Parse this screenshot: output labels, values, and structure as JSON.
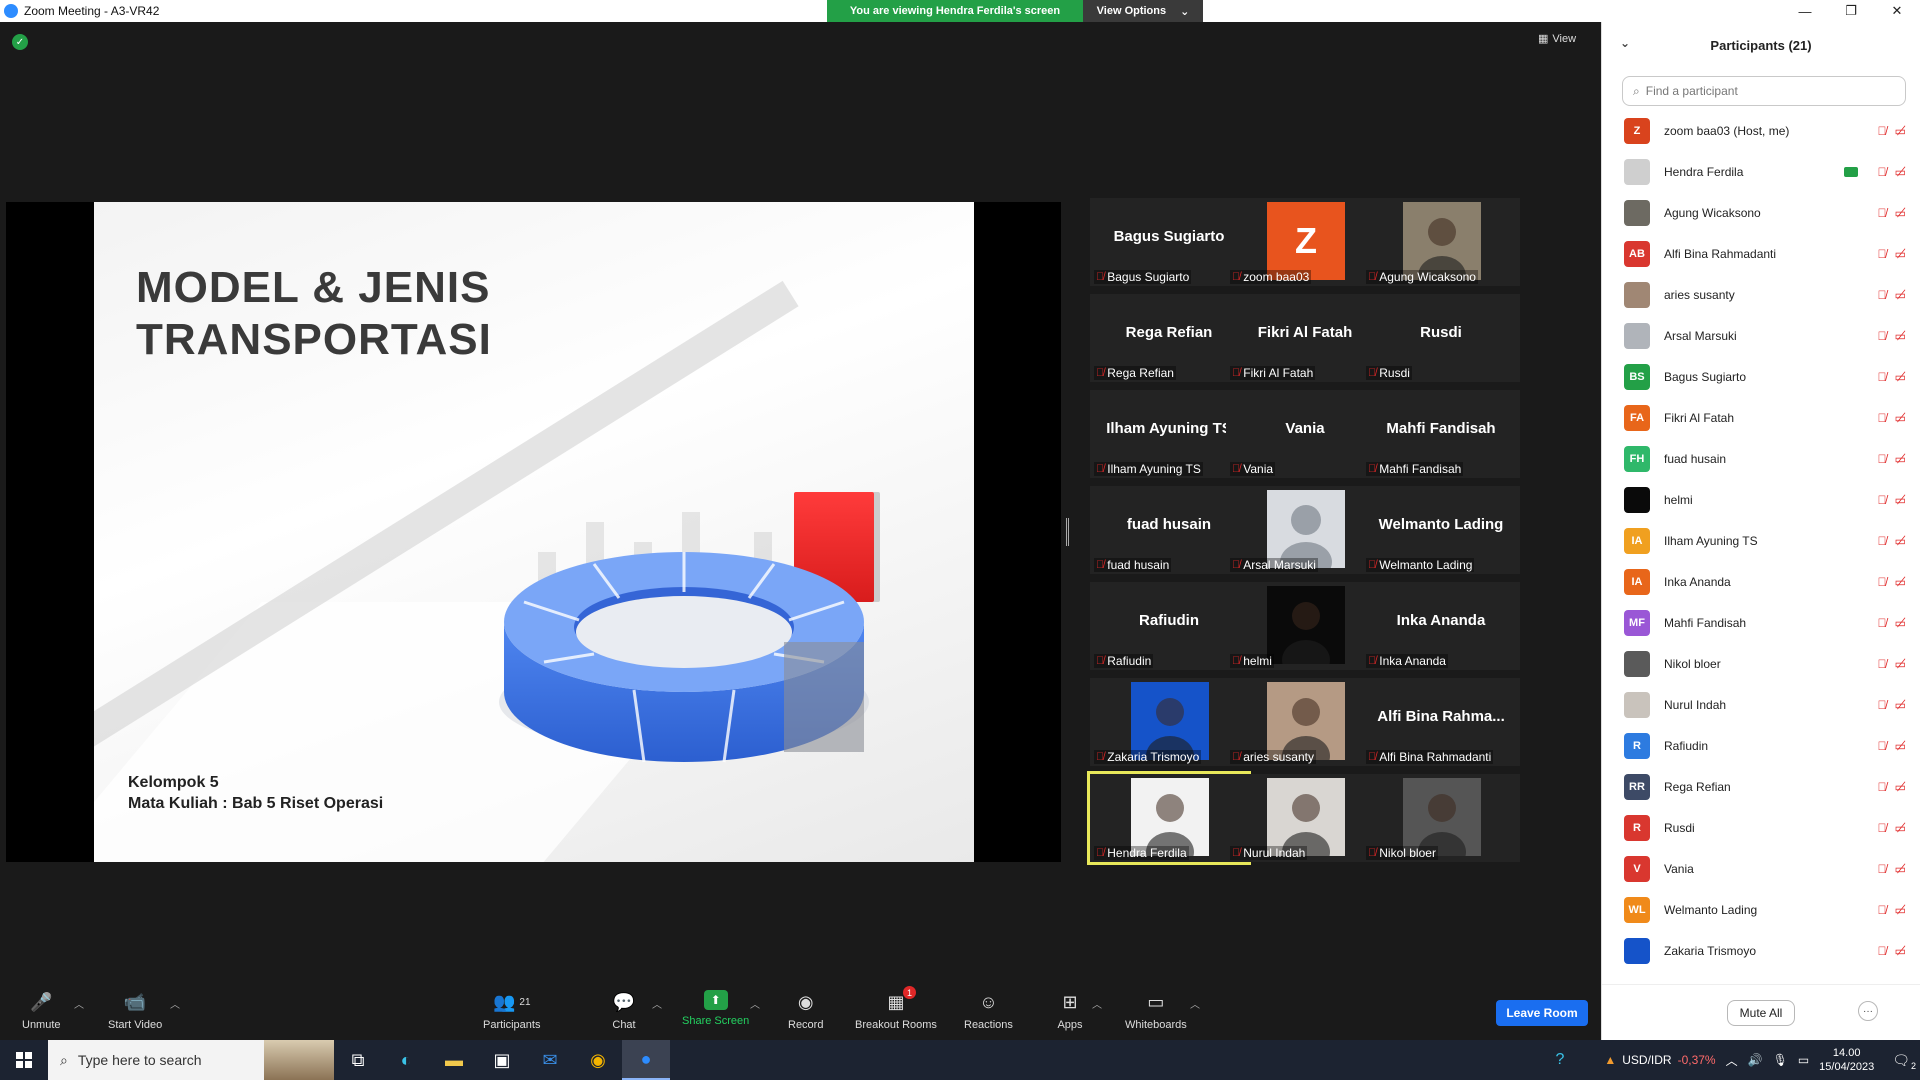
{
  "window": {
    "title": "Zoom Meeting - A3-VR42",
    "minimize": "—",
    "maximize": "❐",
    "close": "✕"
  },
  "share_banner": {
    "text": "You are viewing Hendra Ferdila's screen",
    "view_options": "View Options"
  },
  "view_button": "View",
  "slide": {
    "title_line1": "MODEL & JENIS",
    "title_line2": "TRANSPORTASI",
    "sub_line1": "Kelompok 5",
    "sub_line2": "Mata Kuliah : Bab 5 Riset Operasi"
  },
  "gallery": [
    {
      "big": "Bagus Sugiarto",
      "name": "Bagus Sugiarto",
      "kind": "text"
    },
    {
      "big": "Z",
      "name": "zoom baa03",
      "kind": "letter",
      "color": "#e8541e"
    },
    {
      "big": "",
      "name": "Agung Wicaksono",
      "kind": "photo",
      "color": "#8a7f6c"
    },
    {
      "big": "Rega Refian",
      "name": "Rega Refian",
      "kind": "text"
    },
    {
      "big": "Fikri Al Fatah",
      "name": "Fikri Al Fatah",
      "kind": "text"
    },
    {
      "big": "Rusdi",
      "name": "Rusdi",
      "kind": "text"
    },
    {
      "big": "Ilham Ayuning TS",
      "name": "Ilham Ayuning TS",
      "kind": "text"
    },
    {
      "big": "Vania",
      "name": "Vania",
      "kind": "text"
    },
    {
      "big": "Mahfi Fandisah",
      "name": "Mahfi Fandisah",
      "kind": "text"
    },
    {
      "big": "fuad husain",
      "name": "fuad husain",
      "kind": "text"
    },
    {
      "big": "",
      "name": "Arsal Marsuki",
      "kind": "default"
    },
    {
      "big": "Welmanto Lading",
      "name": "Welmanto Lading",
      "kind": "text"
    },
    {
      "big": "Rafiudin",
      "name": "Rafiudin",
      "kind": "text"
    },
    {
      "big": "",
      "name": "helmi",
      "kind": "photo",
      "color": "#0a0a0a"
    },
    {
      "big": "Inka Ananda",
      "name": "Inka Ananda",
      "kind": "text"
    },
    {
      "big": "",
      "name": "Zakaria Trismoyo",
      "kind": "photo",
      "color": "#1553c9"
    },
    {
      "big": "",
      "name": "aries susanty",
      "kind": "photo",
      "color": "#b59a84"
    },
    {
      "big": "Alfi Bina Rahma...",
      "name": "Alfi Bina Rahmadanti",
      "kind": "text"
    },
    {
      "big": "",
      "name": "Hendra Ferdila",
      "kind": "photo",
      "color": "#f2f2f2",
      "active": true
    },
    {
      "big": "",
      "name": "Nurul Indah",
      "kind": "photo",
      "color": "#d9d6d2"
    },
    {
      "big": "",
      "name": "Nikol bloer",
      "kind": "photo",
      "color": "#555555"
    }
  ],
  "participants_panel": {
    "title": "Participants (21)",
    "search_placeholder": "Find a participant",
    "mute_all": "Mute All",
    "more": "···",
    "list": [
      {
        "initials": "Z",
        "name": "zoom baa03 (Host, me)",
        "color": "#d9431d"
      },
      {
        "initials": "",
        "name": "Hendra Ferdila",
        "color": "#cfcfcf",
        "sharing": true
      },
      {
        "initials": "",
        "name": "Agung Wicaksono",
        "color": "#6d6a62"
      },
      {
        "initials": "AB",
        "name": "Alfi Bina Rahmadanti",
        "color": "#d9372f"
      },
      {
        "initials": "",
        "name": "aries susanty",
        "color": "#a08774"
      },
      {
        "initials": "",
        "name": "Arsal Marsuki",
        "color": "#b0b4ba"
      },
      {
        "initials": "BS",
        "name": "Bagus Sugiarto",
        "color": "#23a047"
      },
      {
        "initials": "FA",
        "name": "Fikri Al Fatah",
        "color": "#e8661a"
      },
      {
        "initials": "FH",
        "name": "fuad husain",
        "color": "#2fb86a"
      },
      {
        "initials": "",
        "name": "helmi",
        "color": "#0a0a0a"
      },
      {
        "initials": "IA",
        "name": "Ilham Ayuning TS",
        "color": "#f0a020"
      },
      {
        "initials": "IA",
        "name": "Inka Ananda",
        "color": "#e8661a"
      },
      {
        "initials": "MF",
        "name": "Mahfi Fandisah",
        "color": "#9a57d6"
      },
      {
        "initials": "",
        "name": "Nikol bloer",
        "color": "#5a5a5a"
      },
      {
        "initials": "",
        "name": "Nurul Indah",
        "color": "#c9c3bc"
      },
      {
        "initials": "R",
        "name": "Rafiudin",
        "color": "#2d7be0"
      },
      {
        "initials": "RR",
        "name": "Rega Refian",
        "color": "#3d4a66"
      },
      {
        "initials": "R",
        "name": "Rusdi",
        "color": "#d9372f"
      },
      {
        "initials": "V",
        "name": "Vania",
        "color": "#d9372f"
      },
      {
        "initials": "WL",
        "name": "Welmanto Lading",
        "color": "#f08a1a"
      },
      {
        "initials": "",
        "name": "Zakaria Trismoyo",
        "color": "#1553c9"
      }
    ]
  },
  "toolbar": {
    "unmute": "Unmute",
    "start_video": "Start Video",
    "participants": "Participants",
    "participants_count": "21",
    "chat": "Chat",
    "share_screen": "Share Screen",
    "record": "Record",
    "breakout_rooms": "Breakout Rooms",
    "breakout_badge": "1",
    "reactions": "Reactions",
    "apps": "Apps",
    "whiteboards": "Whiteboards",
    "leave_room": "Leave Room"
  },
  "taskbar": {
    "search_placeholder": "Type here to search",
    "currency_pair": "USD/IDR",
    "currency_change": "-0,37%",
    "time": "14.00",
    "date": "15/04/2023",
    "notifications": "2"
  }
}
